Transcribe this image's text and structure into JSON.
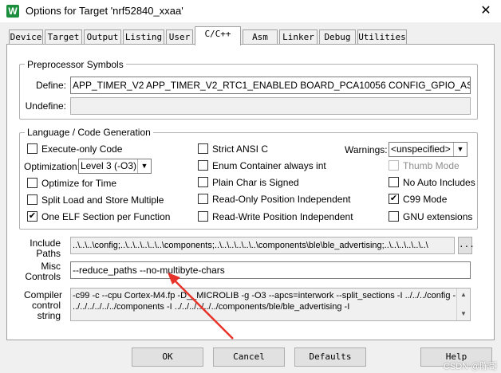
{
  "window": {
    "title": "Options for Target 'nrf52840_xxaa'",
    "icon": "keil-uvision-icon",
    "close_glyph": "✕"
  },
  "tabs": [
    {
      "label": "Device"
    },
    {
      "label": "Target"
    },
    {
      "label": "Output"
    },
    {
      "label": "Listing"
    },
    {
      "label": "User"
    },
    {
      "label": "C/C++",
      "active": true
    },
    {
      "label": "Asm"
    },
    {
      "label": "Linker"
    },
    {
      "label": "Debug"
    },
    {
      "label": "Utilities"
    }
  ],
  "preprocessor": {
    "title": "Preprocessor Symbols",
    "define_label": "Define:",
    "define_value": "APP_TIMER_V2 APP_TIMER_V2_RTC1_ENABLED BOARD_PCA10056 CONFIG_GPIO_AS_PINRESET",
    "undefine_label": "Undefine:",
    "undefine_value": ""
  },
  "language": {
    "title": "Language / Code Generation",
    "execute_only": {
      "label": "Execute-only Code",
      "checked": false
    },
    "optimization_label": "Optimization:",
    "optimization_value": "Level 3 (-O3)",
    "optimize_time": {
      "label": "Optimize for Time",
      "checked": false
    },
    "split_load": {
      "label": "Split Load and Store Multiple",
      "checked": false
    },
    "one_elf": {
      "label": "One ELF Section per Function",
      "checked": true
    },
    "strict_ansi": {
      "label": "Strict ANSI C",
      "checked": false
    },
    "enum_container": {
      "label": "Enum Container always int",
      "checked": false
    },
    "plain_char": {
      "label": "Plain Char is Signed",
      "checked": false
    },
    "ro_pos": {
      "label": "Read-Only Position Independent",
      "checked": false
    },
    "rw_pos": {
      "label": "Read-Write Position Independent",
      "checked": false
    },
    "warnings_label": "Warnings:",
    "warnings_value": "<unspecified>",
    "thumb_mode": {
      "label": "Thumb Mode",
      "checked": false,
      "disabled": true
    },
    "no_auto_includes": {
      "label": "No Auto Includes",
      "checked": false
    },
    "c99_mode": {
      "label": "C99 Mode",
      "checked": true
    },
    "gnu_ext": {
      "label": "GNU extensions",
      "checked": false
    }
  },
  "include_paths": {
    "label_line1": "Include",
    "label_line2": "Paths",
    "value": "..\\..\\..\\config;..\\..\\..\\..\\..\\..\\components;..\\..\\..\\..\\..\\..\\components\\ble\\ble_advertising;..\\..\\..\\..\\..\\..\\",
    "browse_label": "..."
  },
  "misc": {
    "label_line1": "Misc",
    "label_line2": "Controls",
    "value": "--reduce_paths --no-multibyte-chars"
  },
  "compiler": {
    "label_line1": "Compiler",
    "label_line2": "control",
    "label_line3": "string",
    "line1": "-c99 -c --cpu Cortex-M4.fp -D__MICROLIB -g -O3 --apcs=interwork --split_sections -I ../../../config -I",
    "line2": "../../../../../../components -I ../../../../../../components/ble/ble_advertising -I"
  },
  "buttons": {
    "ok": "OK",
    "cancel": "Cancel",
    "defaults": "Defaults",
    "help": "Help"
  },
  "annotation": {
    "arrow_color": "#e8332a"
  },
  "watermark": "CSDN @陈哥"
}
